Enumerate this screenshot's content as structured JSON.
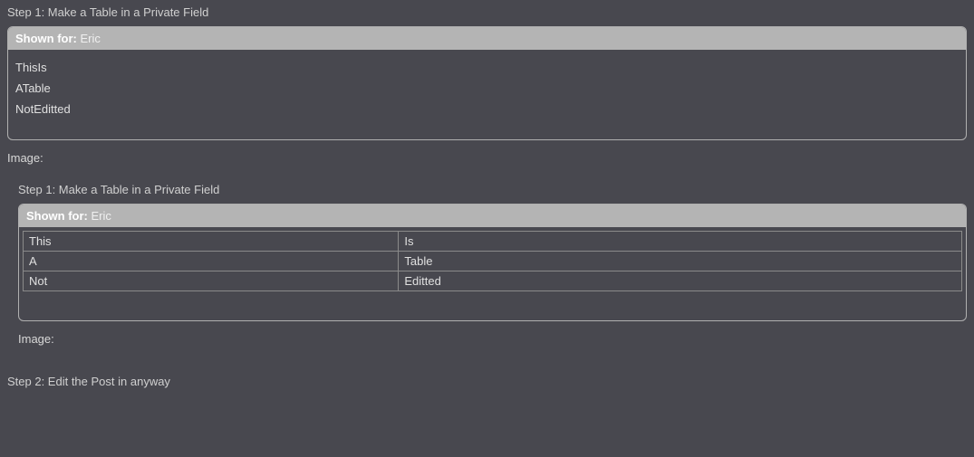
{
  "step1": {
    "title": "Step 1: Make a Table in a Private Field",
    "shown_label": "Shown for:",
    "shown_value": "Eric",
    "lines": [
      "ThisIs",
      "ATable",
      "NotEditted"
    ],
    "image_label": "Image:"
  },
  "nested": {
    "title": "Step 1: Make a Table in a Private Field",
    "shown_label": "Shown for:",
    "shown_value": "Eric",
    "table": [
      {
        "c1": "This",
        "c2": "Is"
      },
      {
        "c1": "A",
        "c2": "Table"
      },
      {
        "c1": "Not",
        "c2": "Editted"
      }
    ],
    "image_label": "Image:"
  },
  "step2": {
    "title": "Step 2: Edit the Post in anyway"
  }
}
